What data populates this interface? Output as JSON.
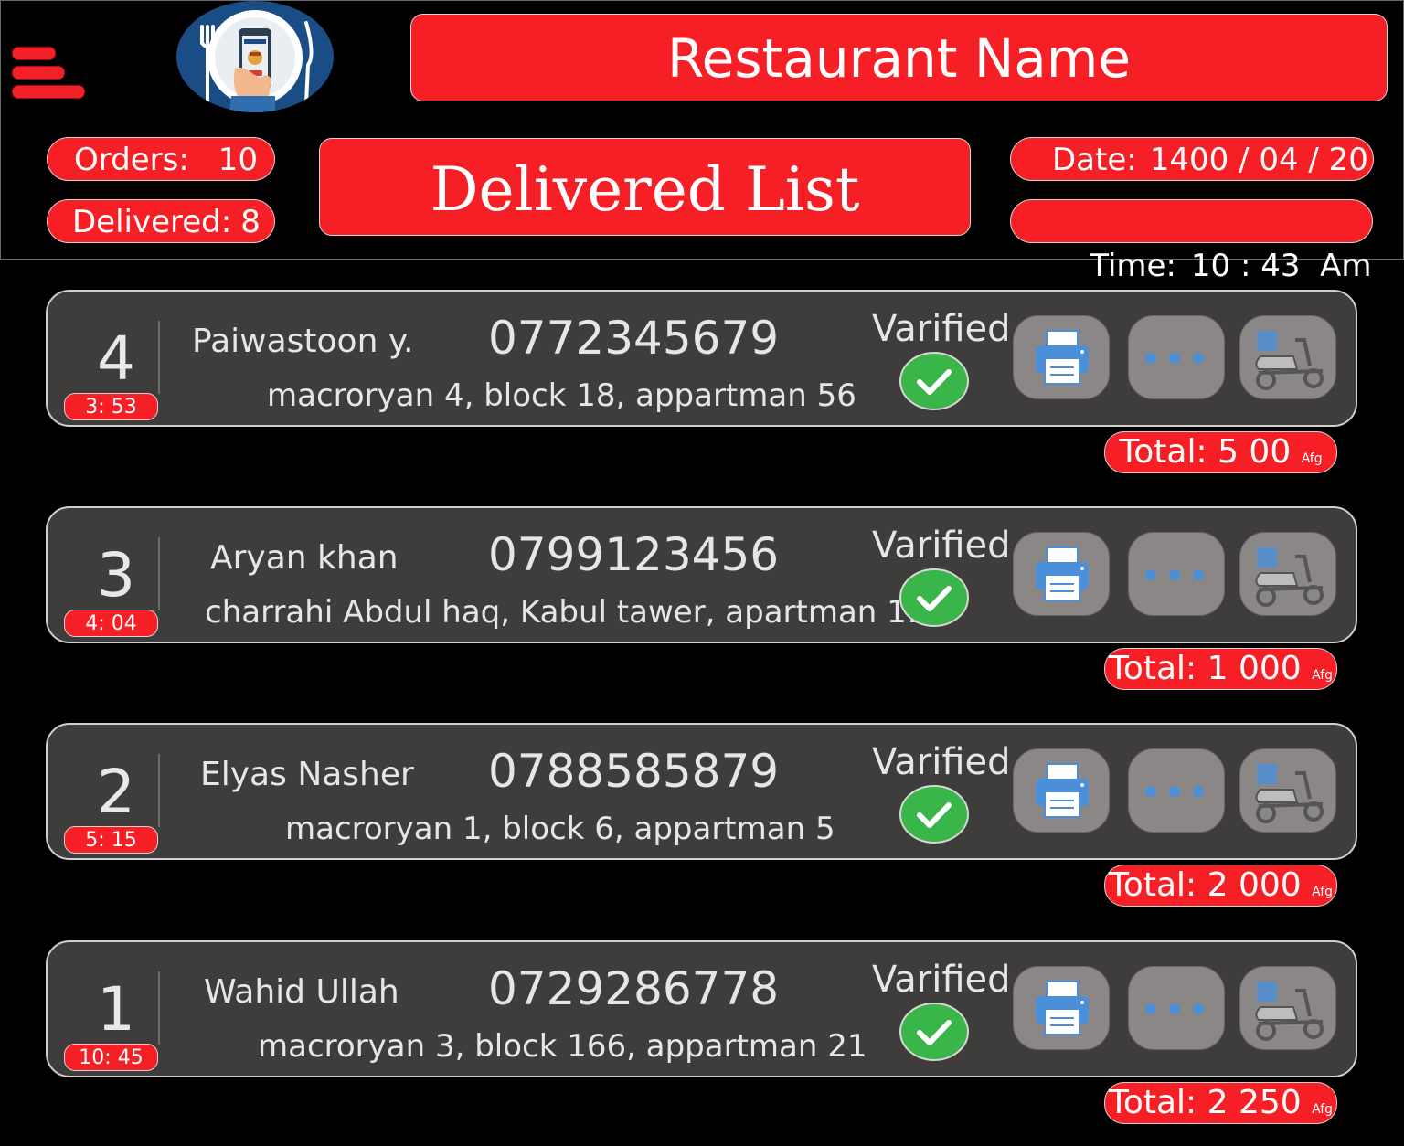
{
  "header": {
    "restaurant_name": "Restaurant Name",
    "title": "Delivered List",
    "orders_label": "Orders:",
    "orders_value": "10",
    "delivered_label": "Delivered:",
    "delivered_value": "8",
    "date_label": "Date:",
    "date_value": "1400 / 04 / 20",
    "time_label": "Time:",
    "time_value": "10 : 43  Am"
  },
  "orders": [
    {
      "num": "4",
      "time": "3: 53",
      "name": "Paiwastoon y.",
      "phone": "0772345679",
      "address": "macroryan 4, block 18, appartman 56",
      "status": "Varified",
      "total_label": "Total:",
      "total_value": "5 00",
      "currency": "Afg"
    },
    {
      "num": "3",
      "time": "4: 04",
      "name": "Aryan khan",
      "phone": "0799123456",
      "address": "charrahi Abdul haq, Kabul tawer, apartman 11",
      "status": "Varified",
      "total_label": "Total:",
      "total_value": "1 000",
      "currency": "Afg"
    },
    {
      "num": "2",
      "time": "5: 15",
      "name": "Elyas Nasher",
      "phone": "0788585879",
      "address": "macroryan 1, block 6, appartman 5",
      "status": "Varified",
      "total_label": "Total:",
      "total_value": "2 000",
      "currency": "Afg"
    },
    {
      "num": "1",
      "time": "10: 45",
      "name": "Wahid Ullah",
      "phone": "0729286778",
      "address": "macroryan 3, block 166, appartman 21",
      "status": "Varified",
      "total_label": "Total:",
      "total_value": "2 250",
      "currency": "Afg"
    }
  ],
  "icons": {
    "menu": "hamburger-menu-icon",
    "logo": "food-order-phone-logo",
    "verified": "check-circle-icon",
    "print": "printer-icon",
    "more": "more-dots-icon",
    "delivery": "delivery-scooter-icon"
  },
  "colors": {
    "accent": "#f71f26",
    "card": "#3f3c3c",
    "button": "#8b8787",
    "verified": "#3ab54a",
    "icon_blue": "#4a8fd8"
  }
}
